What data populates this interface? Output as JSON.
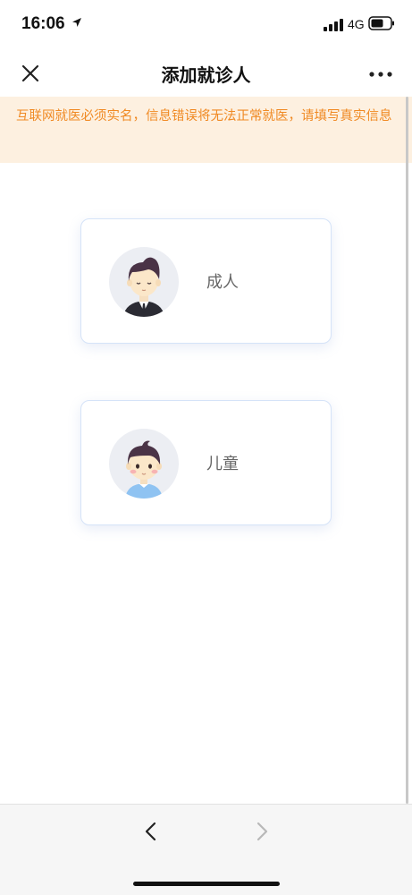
{
  "status_bar": {
    "time": "16:06",
    "network": "4G",
    "icons": [
      "location-arrow-icon",
      "signal-icon",
      "battery-icon"
    ]
  },
  "nav": {
    "title": "添加就诊人",
    "close_icon": "close-icon",
    "more_icon": "more-icon"
  },
  "notice": {
    "text": "互联网就医必须实名，信息错误将无法正常就医，请填写真实信息",
    "color": "#f08a24",
    "background": "#fdf0e0"
  },
  "options": [
    {
      "label": "成人",
      "icon": "adult-avatar-icon"
    },
    {
      "label": "儿童",
      "icon": "child-avatar-icon"
    }
  ],
  "browser_bar": {
    "back_icon": "chevron-left-icon",
    "forward_icon": "chevron-right-icon"
  }
}
